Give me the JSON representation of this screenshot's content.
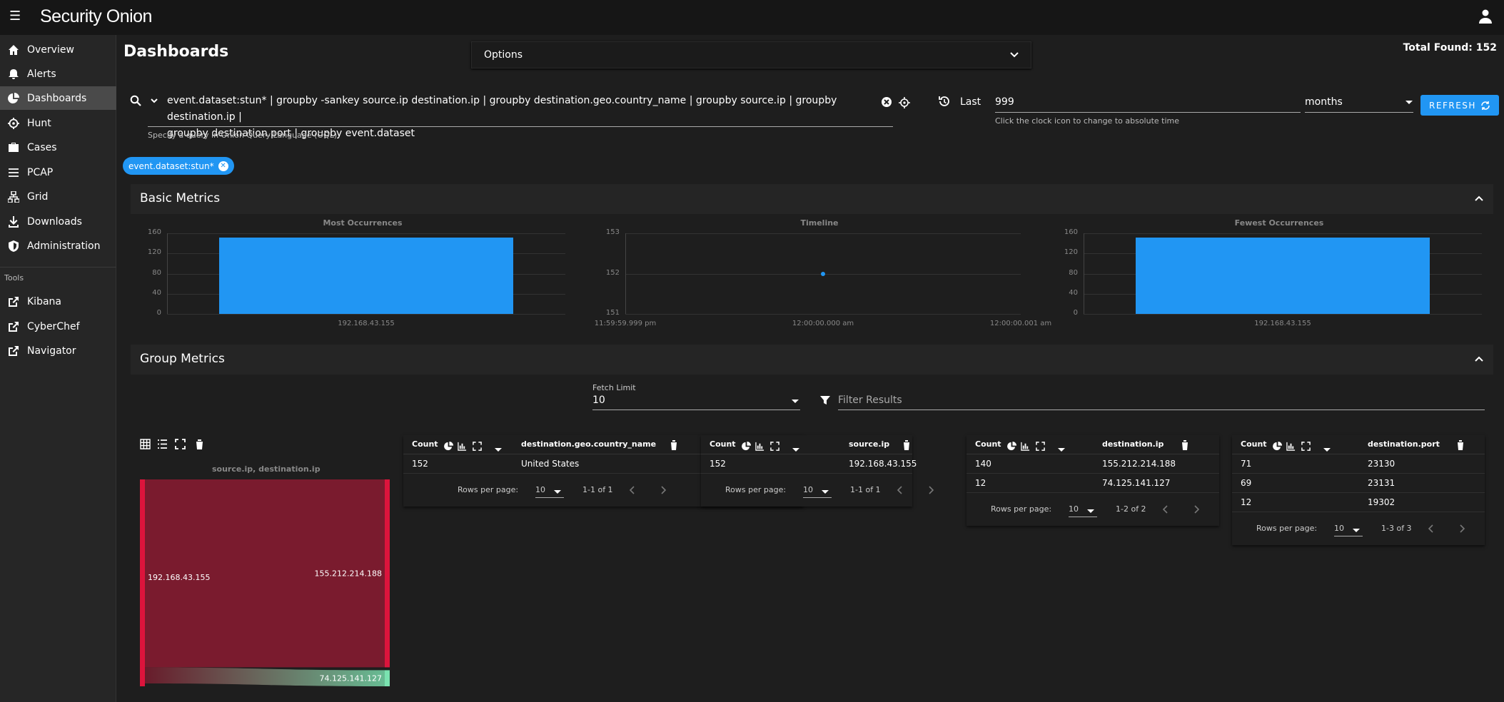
{
  "app": {
    "title": "Security Onion"
  },
  "sidebar": {
    "items": [
      {
        "label": "Overview",
        "icon": "home-icon"
      },
      {
        "label": "Alerts",
        "icon": "bell-icon"
      },
      {
        "label": "Dashboards",
        "icon": "pie-chart-icon"
      },
      {
        "label": "Hunt",
        "icon": "crosshair-icon"
      },
      {
        "label": "Cases",
        "icon": "briefcase-icon"
      },
      {
        "label": "PCAP",
        "icon": "list-icon"
      },
      {
        "label": "Grid",
        "icon": "network-icon"
      },
      {
        "label": "Downloads",
        "icon": "download-icon"
      },
      {
        "label": "Administration",
        "icon": "shield-icon"
      }
    ],
    "tools_label": "Tools",
    "tools": [
      {
        "label": "Kibana",
        "icon": "external-link-icon"
      },
      {
        "label": "CyberChef",
        "icon": "external-link-icon"
      },
      {
        "label": "Navigator",
        "icon": "external-link-icon"
      }
    ]
  },
  "page": {
    "title": "Dashboards",
    "options_label": "Options",
    "total_found": "Total Found: 152"
  },
  "query": {
    "line1": "event.dataset:stun* | groupby -sankey source.ip destination.ip | groupby destination.geo.country_name | groupby source.ip | groupby destination.ip |",
    "line2": "groupby destination.port | groupby event.dataset",
    "hint": "Specify a query in Onion Query Language (OQL)"
  },
  "time": {
    "last_label": "Last",
    "value": "999",
    "hint": "Click the clock icon to change to absolute time",
    "unit": "months",
    "refresh": "REFRESH"
  },
  "filter_chip": "event.dataset:stun*",
  "basic_metrics": {
    "title": "Basic Metrics"
  },
  "chart_data": [
    {
      "type": "bar",
      "title": "Most Occurrences",
      "categories": [
        "192.168.43.155"
      ],
      "values": [
        152
      ],
      "yticks": [
        "160",
        "120",
        "80",
        "40",
        "0"
      ],
      "ylim": [
        0,
        160
      ]
    },
    {
      "type": "scatter",
      "title": "Timeline",
      "x": [
        "12:00:00.000 am"
      ],
      "y": [
        152
      ],
      "xticks": [
        "11:59:59.999 pm",
        "12:00:00.000 am",
        "12:00:00.001 am"
      ],
      "yticks": [
        "153",
        "152",
        "151"
      ],
      "ylim": [
        151,
        153
      ]
    },
    {
      "type": "bar",
      "title": "Fewest Occurrences",
      "categories": [
        "192.168.43.155"
      ],
      "values": [
        152
      ],
      "yticks": [
        "160",
        "120",
        "80",
        "40",
        "0"
      ],
      "ylim": [
        0,
        160
      ]
    }
  ],
  "group_metrics": {
    "title": "Group Metrics",
    "fetch_label": "Fetch Limit",
    "fetch_value": "10",
    "filter_placeholder": "Filter Results"
  },
  "sankey": {
    "title": "source.ip, destination.ip",
    "source": "192.168.43.155",
    "targets": [
      {
        "label": "155.212.214.188",
        "value": 140
      },
      {
        "label": "74.125.141.127",
        "value": 12
      }
    ]
  },
  "tables": [
    {
      "count_label": "Count",
      "field": "destination.geo.country_name",
      "rows": [
        [
          "152",
          "United States"
        ]
      ],
      "rpp": "10",
      "range": "1-1 of 1"
    },
    {
      "count_label": "Count",
      "field": "source.ip",
      "rows": [
        [
          "152",
          "192.168.43.155"
        ]
      ],
      "rpp": "10",
      "range": "1-1 of 1"
    },
    {
      "count_label": "Count",
      "field": "destination.ip",
      "rows": [
        [
          "140",
          "155.212.214.188"
        ],
        [
          "12",
          "74.125.141.127"
        ]
      ],
      "rpp": "10",
      "range": "1-2 of 2"
    },
    {
      "count_label": "Count",
      "field": "destination.port",
      "rows": [
        [
          "71",
          "23130"
        ],
        [
          "69",
          "23131"
        ],
        [
          "12",
          "19302"
        ]
      ],
      "rpp": "10",
      "range": "1-3 of 3"
    }
  ],
  "rows_per_page_label": "Rows per page:",
  "colors": {
    "accent": "#2196f3",
    "sankey_main": "#7a1b2e",
    "sankey_node": "#dc143c",
    "sankey_alt": "#7ae2b0"
  }
}
